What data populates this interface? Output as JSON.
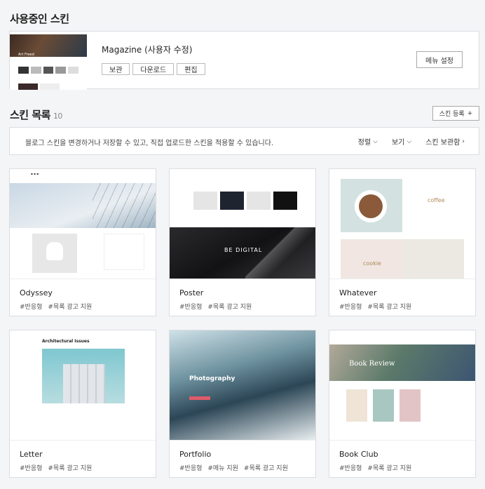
{
  "current": {
    "heading": "사용중인 스킨",
    "skin_name": "Magazine (사용자 수정)",
    "buttons": [
      "보관",
      "다운로드",
      "편집"
    ],
    "menu_button": "메뉴 설정"
  },
  "list": {
    "heading": "스킨 목록",
    "count": "10",
    "register_button": "스킨 등록",
    "notice": "블로그 스킨을 변경하거나 저장할 수 있고, 직접 업로드한 스킨을 적용할 수 있습니다.",
    "tools": {
      "sort": "정렬",
      "view": "보기",
      "storage": "스킨 보관함"
    }
  },
  "skins": [
    {
      "name": "Odyssey",
      "tags": [
        "#반응형",
        "#목록 광고 지원"
      ]
    },
    {
      "name": "Poster",
      "tags": [
        "#반응형",
        "#목록 광고 지원"
      ]
    },
    {
      "name": "Whatever",
      "tags": [
        "#반응형",
        "#목록 광고 지원"
      ]
    },
    {
      "name": "Letter",
      "tags": [
        "#반응형",
        "#목록 광고 지원"
      ]
    },
    {
      "name": "Portfolio",
      "tags": [
        "#반응형",
        "#메뉴 지원",
        "#목록 광고 지원"
      ]
    },
    {
      "name": "Book Club",
      "tags": [
        "#반응형",
        "#목록 광고 지원"
      ]
    }
  ],
  "thumb_text": {
    "magazine": "Art Freed",
    "poster": "BE DIGITAL",
    "whatever_coffee": "coffee",
    "whatever_cookie": "cookie",
    "letter": "Architectural Issues",
    "portfolio": "Photography",
    "bookclub": "Book Review"
  }
}
